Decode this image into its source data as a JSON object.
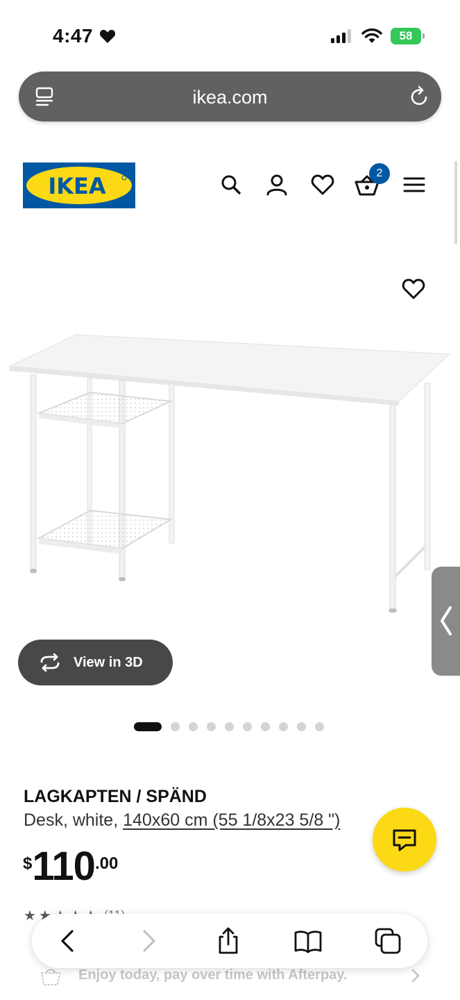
{
  "status_bar": {
    "time": "4:47",
    "battery": "58"
  },
  "browser": {
    "url": "ikea.com"
  },
  "header": {
    "logo_text": "IKEA",
    "cart_count": "2",
    "colors": {
      "brand_blue": "#0058a3",
      "brand_yellow": "#fbd914"
    }
  },
  "gallery": {
    "view3d_label": "View in 3D",
    "dot_count": 10,
    "active_index": 0
  },
  "product": {
    "name": "LAGKAPTEN / SPÄND",
    "description": "Desk, white, ",
    "size": "140x60 cm (55 1/8x23 5/8 \")",
    "price_currency": "$",
    "price_main": "110",
    "price_cents": ".00",
    "rating_count": "(11)"
  },
  "promo": {
    "afterpay_text": "Enjoy today, pay over time with Afterpay."
  }
}
